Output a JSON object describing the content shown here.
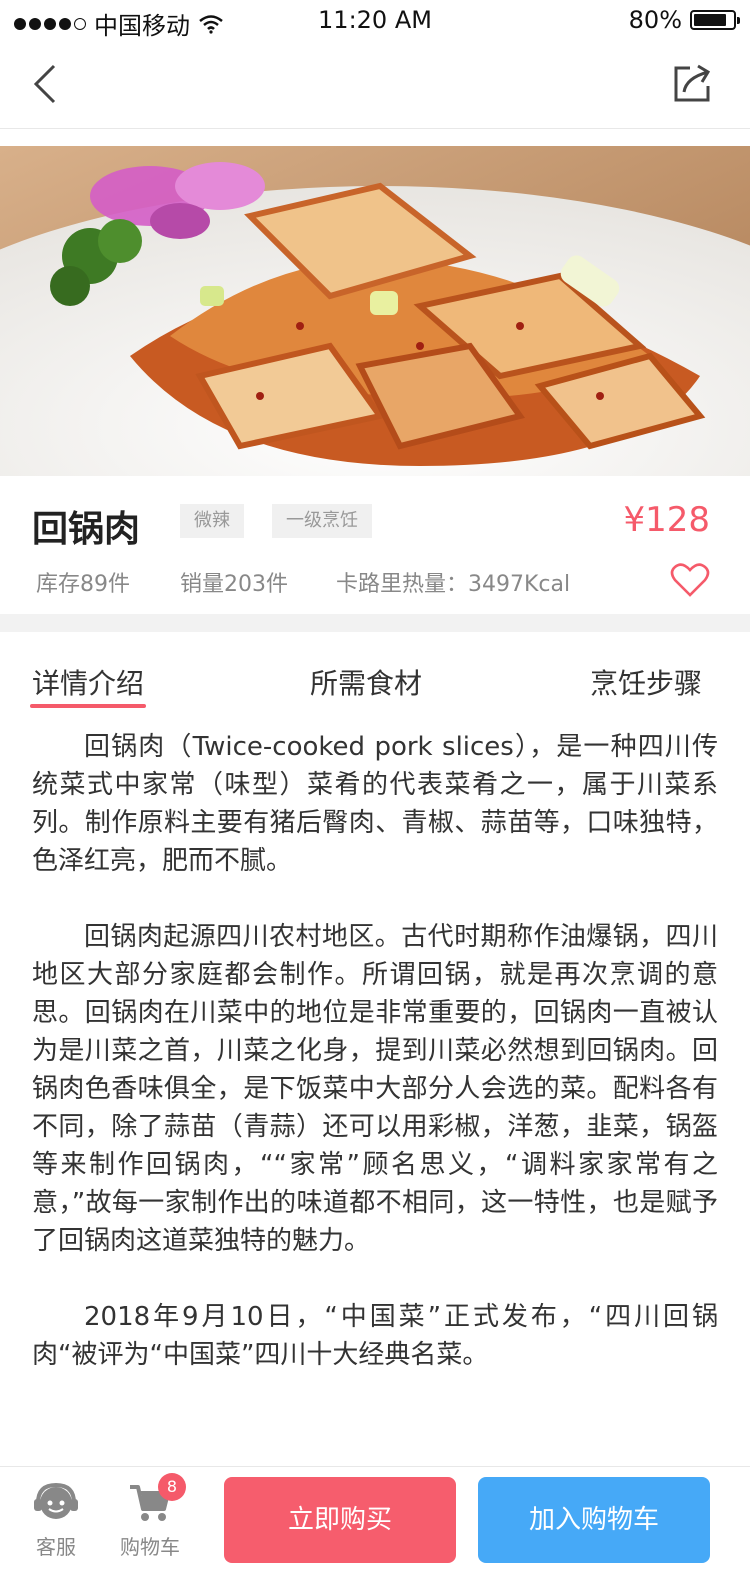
{
  "status_bar": {
    "carrier": "中国移动",
    "time": "11:20 AM",
    "battery": "80%"
  },
  "product": {
    "name": "回锅肉",
    "tags": [
      "微辣",
      "一级烹饪"
    ],
    "price": "¥128",
    "stock": "库存89件",
    "sales": "销量203件",
    "calories": "卡路里热量：3497Kcal"
  },
  "tabs": [
    "详情介绍",
    "所需食材",
    "烹饪步骤"
  ],
  "article": [
    "回锅肉（Twice-cooked pork slices），是一种四川传统菜式中家常（味型）菜肴的代表菜肴之一，属于川菜系列。制作原料主要有猪后臀肉、青椒、蒜苗等，口味独特，色泽红亮，肥而不腻。",
    "回锅肉起源四川农村地区。古代时期称作油爆锅，四川地区大部分家庭都会制作。所谓回锅，就是再次烹调的意思。回锅肉在川菜中的地位是非常重要的，回锅肉一直被认为是川菜之首，川菜之化身，提到川菜必然想到回锅肉。回锅肉色香味俱全，是下饭菜中大部分人会选的菜。配料各有不同，除了蒜苗（青蒜）还可以用彩椒，洋葱，韭菜，锅盔等来制作回锅肉，““家常”顾名思义，“调料家家常有之意，”故每一家制作出的味道都不相同，这一特性，也是赋予了回锅肉这道菜独特的魅力。",
    "2018年9月10日，“中国菜”正式发布，“四川回锅肉“被评为“中国菜”四川十大经典名菜。"
  ],
  "bottom_bar": {
    "service_label": "客服",
    "cart_label": "购物车",
    "cart_count": "8",
    "buy_now": "立即购买",
    "add_to_cart": "加入购物车"
  },
  "colors": {
    "accent": "#f55a6a",
    "cart_button": "#46a9f7",
    "buy_button": "#f65d6d"
  },
  "icons": [
    "back-icon",
    "share-icon",
    "heart-icon",
    "customer-service-icon",
    "cart-icon",
    "wifi-icon",
    "battery-icon"
  ]
}
